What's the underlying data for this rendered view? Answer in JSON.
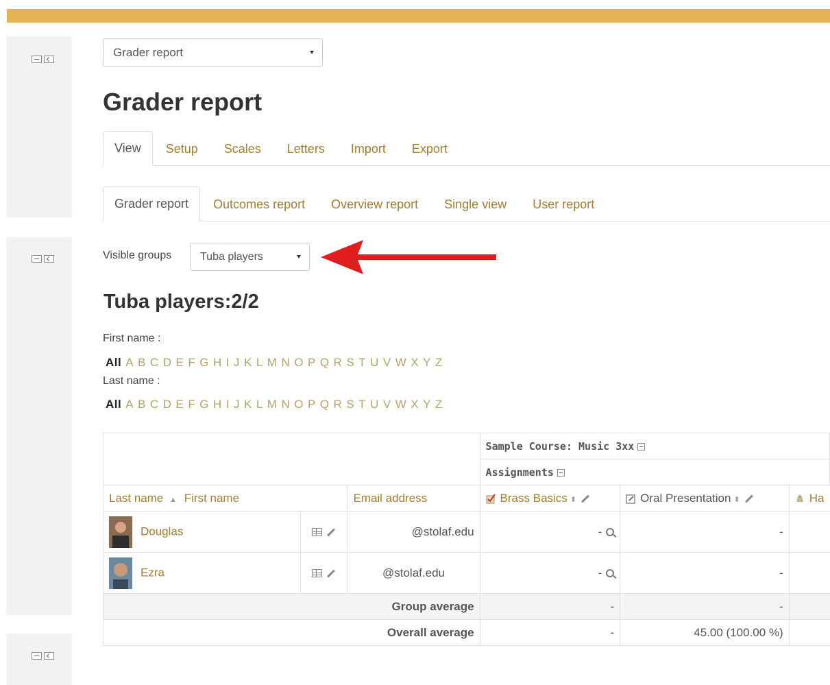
{
  "report_selector": {
    "value": "Grader report"
  },
  "page_title": "Grader report",
  "main_tabs": [
    {
      "label": "View",
      "active": true
    },
    {
      "label": "Setup"
    },
    {
      "label": "Scales"
    },
    {
      "label": "Letters"
    },
    {
      "label": "Import"
    },
    {
      "label": "Export"
    }
  ],
  "sub_tabs": [
    {
      "label": "Grader report",
      "active": true
    },
    {
      "label": "Outcomes report"
    },
    {
      "label": "Overview report"
    },
    {
      "label": "Single view"
    },
    {
      "label": "User report"
    }
  ],
  "groups": {
    "label": "Visible groups",
    "selected": "Tuba players"
  },
  "group_heading": "Tuba players:2/2",
  "initials": {
    "first_name_label": "First name :",
    "last_name_label": "Last name :",
    "all_label": "All",
    "letters": [
      "A",
      "B",
      "C",
      "D",
      "E",
      "F",
      "G",
      "H",
      "I",
      "J",
      "K",
      "L",
      "M",
      "N",
      "O",
      "P",
      "Q",
      "R",
      "S",
      "T",
      "U",
      "V",
      "W",
      "X",
      "Y",
      "Z"
    ]
  },
  "table": {
    "course_category": "Sample Course: Music 3xx",
    "assignments_category": "Assignments",
    "col_last_name": "Last name",
    "col_first_name": "First name",
    "col_email": "Email address",
    "items": [
      {
        "name": "Brass Basics"
      },
      {
        "name": "Oral Presentation"
      },
      {
        "name": "Ha"
      }
    ],
    "students": [
      {
        "first_name": "Douglas",
        "email": "@stolaf.edu",
        "grade1": "-",
        "grade2": "-"
      },
      {
        "first_name": "Ezra",
        "email": "@stolaf.edu",
        "grade1": "-",
        "grade2": "-"
      }
    ],
    "group_average": {
      "label": "Group average",
      "v1": "-",
      "v2": "-"
    },
    "overall_average": {
      "label": "Overall average",
      "v1": "-",
      "v2": "45.00 (100.00 %)"
    }
  },
  "colors": {
    "accent_bar": "#e3b356",
    "link": "#a27e32",
    "arrow": "#e11d1d"
  }
}
